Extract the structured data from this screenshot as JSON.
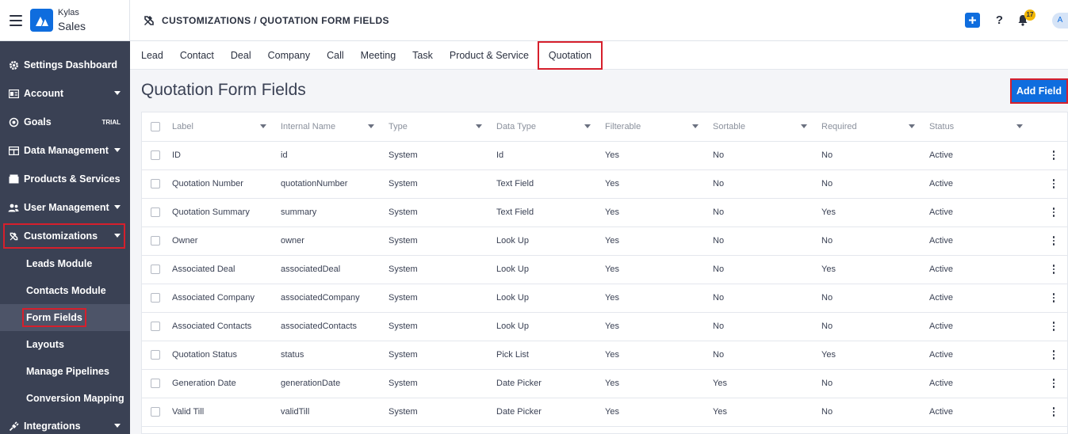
{
  "app": {
    "brand_small": "Kylas",
    "brand_name": "Sales"
  },
  "header": {
    "breadcrumb": "CUSTOMIZATIONS / QUOTATION FORM FIELDS",
    "notification_count": "17",
    "avatar_initial": "A"
  },
  "sidebar": {
    "items": [
      {
        "label": "Settings Dashboard",
        "icon": "gear-icon"
      },
      {
        "label": "Account",
        "icon": "account-card-icon",
        "caret": true
      },
      {
        "label": "Goals",
        "icon": "target-icon",
        "badge": "TRIAL"
      },
      {
        "label": "Data Management",
        "icon": "table-icon",
        "caret": true
      },
      {
        "label": "Products & Services",
        "icon": "box-icon"
      },
      {
        "label": "User Management",
        "icon": "users-icon",
        "caret": true
      },
      {
        "label": "Customizations",
        "icon": "tools-icon",
        "caret": true
      }
    ],
    "sub_items": [
      "Leads Module",
      "Contacts Module",
      "Form Fields",
      "Layouts",
      "Manage Pipelines",
      "Conversion Mapping"
    ],
    "bottom_item": {
      "label": "Integrations",
      "icon": "plug-icon",
      "caret": true
    }
  },
  "tabs": [
    "Lead",
    "Contact",
    "Deal",
    "Company",
    "Call",
    "Meeting",
    "Task",
    "Product & Service",
    "Quotation"
  ],
  "active_tab": "Quotation",
  "page": {
    "title": "Quotation Form Fields",
    "add_button": "Add Field"
  },
  "table": {
    "columns": [
      "Label",
      "Internal Name",
      "Type",
      "Data Type",
      "Filterable",
      "Sortable",
      "Required",
      "Status"
    ],
    "rows": [
      [
        "ID",
        "id",
        "System",
        "Id",
        "Yes",
        "No",
        "No",
        "Active"
      ],
      [
        "Quotation Number",
        "quotationNumber",
        "System",
        "Text Field",
        "Yes",
        "No",
        "No",
        "Active"
      ],
      [
        "Quotation Summary",
        "summary",
        "System",
        "Text Field",
        "Yes",
        "No",
        "Yes",
        "Active"
      ],
      [
        "Owner",
        "owner",
        "System",
        "Look Up",
        "Yes",
        "No",
        "No",
        "Active"
      ],
      [
        "Associated Deal",
        "associatedDeal",
        "System",
        "Look Up",
        "Yes",
        "No",
        "Yes",
        "Active"
      ],
      [
        "Associated Company",
        "associatedCompany",
        "System",
        "Look Up",
        "Yes",
        "No",
        "No",
        "Active"
      ],
      [
        "Associated Contacts",
        "associatedContacts",
        "System",
        "Look Up",
        "Yes",
        "No",
        "No",
        "Active"
      ],
      [
        "Quotation Status",
        "status",
        "System",
        "Pick List",
        "Yes",
        "No",
        "Yes",
        "Active"
      ],
      [
        "Generation Date",
        "generationDate",
        "System",
        "Date Picker",
        "Yes",
        "Yes",
        "No",
        "Active"
      ],
      [
        "Valid Till",
        "validTill",
        "System",
        "Date Picker",
        "Yes",
        "Yes",
        "No",
        "Active"
      ]
    ]
  },
  "colors": {
    "primary": "#0f6dde",
    "sidebar": "#3a4154",
    "highlight": "#d61f2c"
  }
}
